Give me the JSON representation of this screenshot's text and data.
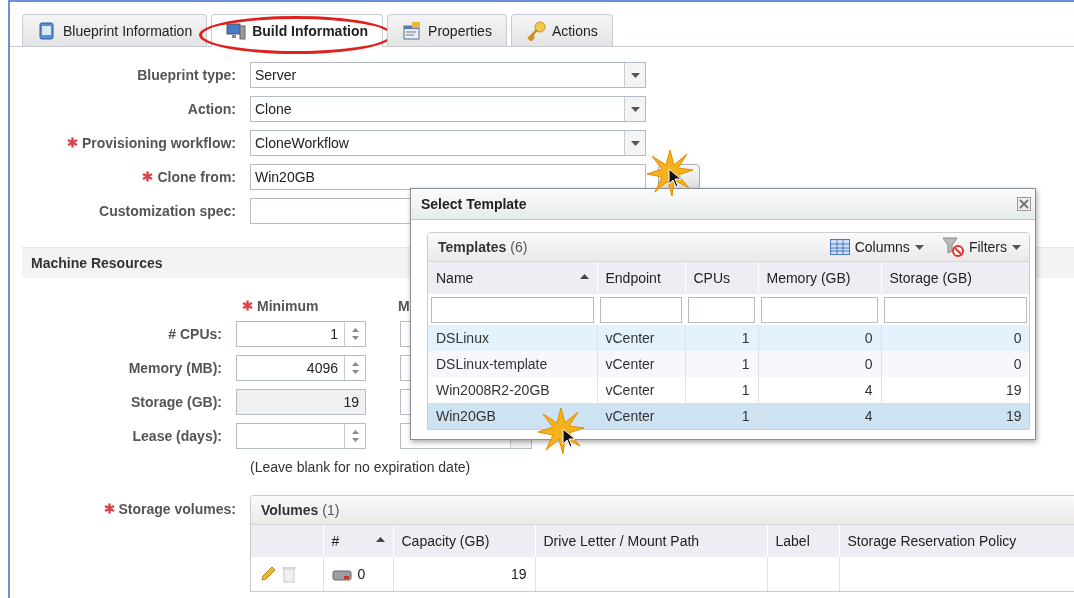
{
  "tabs": [
    {
      "label": "Blueprint Information",
      "selected": false
    },
    {
      "label": "Build Information",
      "selected": true
    },
    {
      "label": "Properties",
      "selected": false
    },
    {
      "label": "Actions",
      "selected": false
    }
  ],
  "form": {
    "fields": [
      {
        "label": "Blueprint type:",
        "required": false,
        "kind": "dropdown",
        "value": "Server"
      },
      {
        "label": "Action:",
        "required": false,
        "kind": "dropdown",
        "value": "Clone"
      },
      {
        "label": "Provisioning workflow:",
        "required": true,
        "kind": "dropdown",
        "value": "CloneWorkflow"
      },
      {
        "label": "Clone from:",
        "required": true,
        "kind": "lookup",
        "value": "Win20GB"
      },
      {
        "label": "Customization spec:",
        "required": false,
        "kind": "text"
      }
    ]
  },
  "machine_resources": {
    "title": "Machine Resources",
    "minimum_header": "Minimum",
    "minimum_required": true,
    "maximum_header": "M",
    "rows": [
      {
        "label": "# CPUs:",
        "kind": "spinner",
        "value": "1"
      },
      {
        "label": "Memory (MB):",
        "kind": "spinner",
        "value": "4096"
      },
      {
        "label": "Storage (GB):",
        "kind": "readonly",
        "value": "19"
      },
      {
        "label": "Lease (days):",
        "kind": "spinner"
      }
    ],
    "note": "(Leave blank for no expiration date)"
  },
  "storage_volumes": {
    "label": "Storage volumes:",
    "required": true,
    "grid_title": "Volumes",
    "count": "(1)",
    "columns": [
      {
        "label": "#",
        "sorted": true
      },
      {
        "label": "Capacity (GB)",
        "sorted": false
      },
      {
        "label": "Drive Letter / Mount Path",
        "sorted": false
      },
      {
        "label": "Label",
        "sorted": false
      },
      {
        "label": "Storage Reservation Policy",
        "sorted": false
      }
    ],
    "rows": [
      {
        "number": "0",
        "capacity": "19"
      }
    ]
  },
  "dialog": {
    "title": "Select Template",
    "grid_title": "Templates",
    "count": "(6)",
    "toolbar": [
      "Columns",
      "Filters"
    ],
    "columns": [
      {
        "label": "Name",
        "sorted": true
      },
      {
        "label": "Endpoint",
        "sorted": false
      },
      {
        "label": "CPUs",
        "sorted": false
      },
      {
        "label": "Memory (GB)",
        "sorted": false
      },
      {
        "label": "Storage (GB)",
        "sorted": false
      }
    ],
    "rows": [
      {
        "cells": [
          "DSLinux",
          "vCenter",
          "1",
          "0",
          "0"
        ],
        "hovered": true,
        "selected": false
      },
      {
        "cells": [
          "DSLinux-template",
          "vCenter",
          "1",
          "0",
          "0"
        ],
        "hovered": false,
        "selected": false
      },
      {
        "cells": [
          "Win2008R2-20GB",
          "vCenter",
          "1",
          "4",
          "19"
        ],
        "hovered": false,
        "selected": false
      },
      {
        "cells": [
          "Win20GB",
          "vCenter",
          "1",
          "4",
          "19"
        ],
        "hovered": false,
        "selected": true
      }
    ]
  }
}
